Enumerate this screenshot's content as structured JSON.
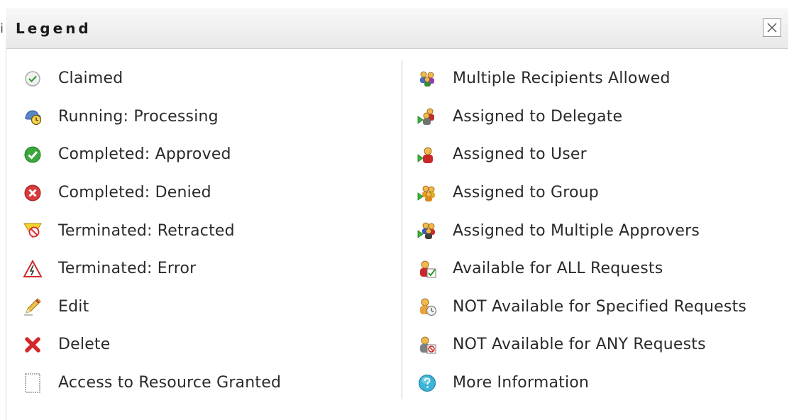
{
  "dialog": {
    "title": "Legend",
    "close_icon": "close-icon"
  },
  "left_column": [
    {
      "label": "Claimed",
      "icon": "claimed-icon"
    },
    {
      "label": "Running: Processing",
      "icon": "running-processing-icon"
    },
    {
      "label": "Completed: Approved",
      "icon": "approved-icon"
    },
    {
      "label": "Completed: Denied",
      "icon": "denied-icon"
    },
    {
      "label": "Terminated: Retracted",
      "icon": "retracted-icon"
    },
    {
      "label": "Terminated: Error",
      "icon": "error-icon"
    },
    {
      "label": "Edit",
      "icon": "edit-icon"
    },
    {
      "label": "Delete",
      "icon": "delete-icon"
    },
    {
      "label": "Access to Resource Granted",
      "icon": "access-granted-icon"
    }
  ],
  "right_column": [
    {
      "label": "Multiple Recipients Allowed",
      "icon": "multiple-recipients-icon"
    },
    {
      "label": "Assigned to Delegate",
      "icon": "assigned-delegate-icon"
    },
    {
      "label": "Assigned to User",
      "icon": "assigned-user-icon"
    },
    {
      "label": "Assigned to Group",
      "icon": "assigned-group-icon"
    },
    {
      "label": "Assigned to Multiple Approvers",
      "icon": "assigned-multiple-approvers-icon"
    },
    {
      "label": "Available for ALL Requests",
      "icon": "available-all-icon"
    },
    {
      "label": "NOT Available for Specified Requests",
      "icon": "not-available-specified-icon"
    },
    {
      "label": "NOT Available for ANY Requests",
      "icon": "not-available-any-icon"
    },
    {
      "label": "More Information",
      "icon": "more-information-icon"
    }
  ]
}
